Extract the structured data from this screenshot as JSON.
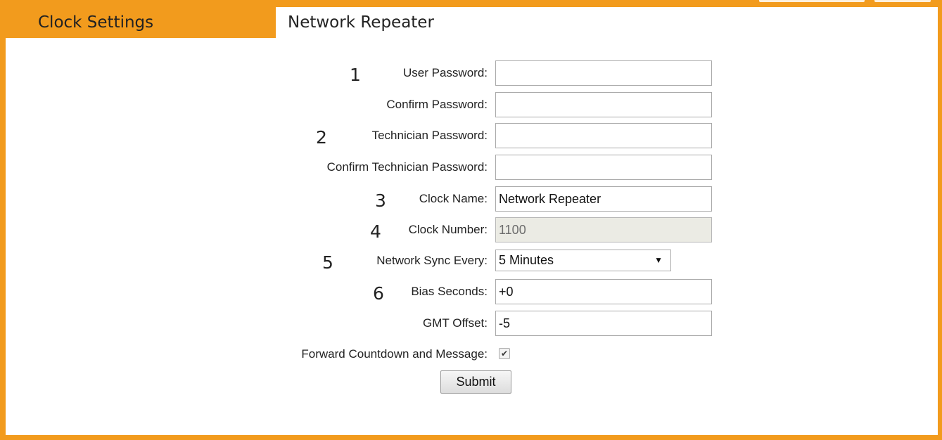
{
  "tabs": {
    "clock_settings": "Clock Settings",
    "network_repeater": "Network Repeater"
  },
  "form": {
    "user_password": {
      "number": "1",
      "label": "User Password:",
      "value": ""
    },
    "confirm_password": {
      "label": "Confirm Password:",
      "value": ""
    },
    "technician_password": {
      "number": "2",
      "label": "Technician Password:",
      "value": ""
    },
    "confirm_technician_password": {
      "label": "Confirm Technician Password:",
      "value": ""
    },
    "clock_name": {
      "number": "3",
      "label": "Clock Name:",
      "value": "Network Repeater"
    },
    "clock_number": {
      "number": "4",
      "label": "Clock Number:",
      "value": "1100"
    },
    "network_sync": {
      "number": "5",
      "label": "Network Sync Every:",
      "value": "5 Minutes"
    },
    "bias_seconds": {
      "number": "6",
      "label": "Bias Seconds:",
      "value": "+0"
    },
    "gmt_offset": {
      "label": "GMT Offset:",
      "value": "-5"
    },
    "forward_countdown": {
      "label": "Forward Countdown and Message:",
      "checked": true,
      "check_glyph": "✔"
    },
    "submit_label": "Submit"
  },
  "colors": {
    "accent": "#f29b1d"
  },
  "icons": {
    "select_arrow": "chevron-down-icon",
    "checkbox": "check-icon"
  }
}
